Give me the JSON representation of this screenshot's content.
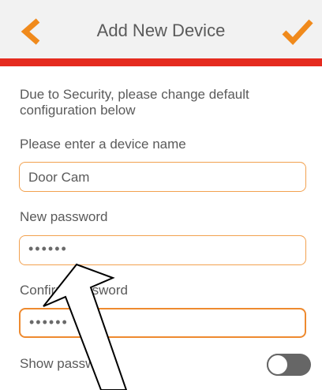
{
  "header": {
    "title": "Add New Device",
    "back_icon": "chevron-left-icon",
    "confirm_icon": "checkmark-icon",
    "accent_color": "#f08a1c",
    "bar_color": "#e52b1f"
  },
  "form": {
    "intro": "Due to Security, please change default configuration below",
    "device_name": {
      "label": "Please enter a device name",
      "value": "Door Cam"
    },
    "new_password": {
      "label": "New password",
      "masked_value": "••••••"
    },
    "confirm_password": {
      "label": "Confirm password",
      "masked_value": "••••••"
    },
    "show_password": {
      "label": "Show password",
      "state": "off"
    }
  }
}
